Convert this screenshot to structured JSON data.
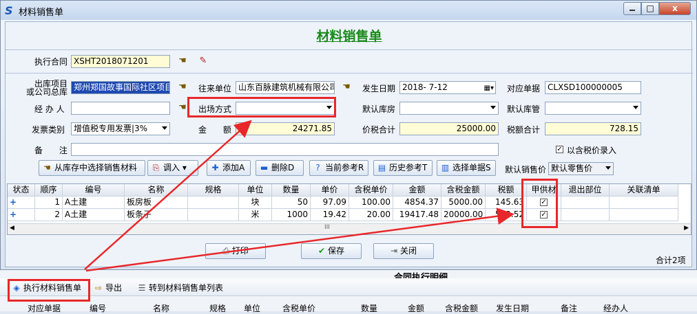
{
  "window": {
    "title": "材料销售单",
    "min_label": "",
    "max_label": "□",
    "close_label": "x"
  },
  "form": {
    "title": "材料销售单",
    "contract_label": "执行合同",
    "contract_value": "XSHT2018071201",
    "warehouse_label": "出库项目\n或公司总库",
    "warehouse_value": "郑州郑国故事国际社区项目",
    "partner_label": "往来单位",
    "partner_value": "山东百脉建筑机械有限公司",
    "date_label": "发生日期",
    "date_value": "2018- 7-12",
    "ref_label": "对应单据",
    "ref_value": "CLXSD100000005",
    "handler_label": "经 办 人",
    "handler_value": "",
    "out_method_label": "出场方式",
    "out_method_value": "",
    "default_store_label": "默认库房",
    "default_store_value": "",
    "default_keeper_label": "默认库管",
    "default_keeper_value": "",
    "invoice_label": "发票类别",
    "invoice_value": "增值税专用发票|3%",
    "amount_label": "金 额",
    "amount_value": "24271.85",
    "taxsum_label": "价税合计",
    "taxsum_value": "25000.00",
    "taxtotal_label": "税额合计",
    "taxtotal_value": "728.15",
    "note_label": "备 注",
    "note_value": "",
    "taxin_label": "以含税价录入"
  },
  "toolbar": {
    "select_stock": "从库存中选择销售材料",
    "import": "调入",
    "add": "添加A",
    "delete": "删除D",
    "current_ref": "当前参考R",
    "history_ref": "历史参考T",
    "select_doc": "选择单据S",
    "default_price_label": "默认销售价",
    "default_price_value": "默认零售价"
  },
  "grid": {
    "headers": [
      "状态",
      "顺序",
      "编号",
      "名称",
      "规格",
      "单位",
      "数量",
      "单价",
      "含税单价",
      "金额",
      "含税金额",
      "税额",
      "甲供材",
      "退出部位",
      "关联清单"
    ],
    "rows": [
      {
        "status": "+",
        "seq": "1",
        "code": "A土建",
        "name": "板房板",
        "spec": "",
        "unit": "块",
        "qty": "50",
        "price": "97.09",
        "taxprice": "100.00",
        "amount": "4854.37",
        "taxamount": "5000.00",
        "tax": "145.63",
        "supplied": "✓",
        "exit": "",
        "link": ""
      },
      {
        "status": "+",
        "seq": "2",
        "code": "A土建",
        "name": "板条子",
        "spec": "",
        "unit": "米",
        "qty": "1000",
        "price": "19.42",
        "taxprice": "20.00",
        "amount": "19417.48",
        "taxamount": "20000.00",
        "tax": "582.52",
        "supplied": "✓",
        "exit": "",
        "link": ""
      }
    ],
    "scroll_mark": "III"
  },
  "bottom": {
    "print": "打印",
    "save": "保存",
    "close": "关闭",
    "total": "合计2项"
  },
  "lower": {
    "section_title": "合同执行明细",
    "execute": "执行材料销售单",
    "export": "导出",
    "goto_list": "转到材料销售单列表",
    "headers": [
      "对应单据",
      "编号",
      "名称",
      "规格",
      "单位",
      "含税单价",
      "数量",
      "金额",
      "含税金额",
      "发生日期",
      "备注",
      "经办人"
    ]
  },
  "colors": {
    "title_green": "#1a8a1a",
    "highlight_red": "#e8272a",
    "selection_blue": "#1e49b0",
    "yellow_field": "#fffcd6"
  }
}
